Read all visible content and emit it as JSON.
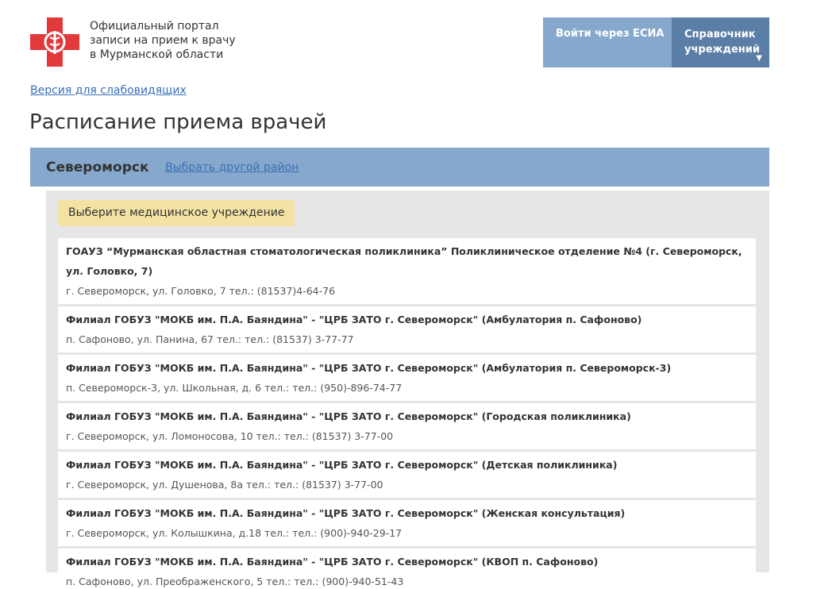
{
  "header": {
    "portal_title_lines": [
      "Официальный портал",
      "записи на прием к врачу",
      "в Мурманской области"
    ],
    "esia_button": "Войти через ЕСИА",
    "directory_button_lines": [
      "Справочник",
      "учреждений"
    ],
    "caret": "▼"
  },
  "accessibility_link": "Версия для слабовидящих",
  "page_title": "Расписание приема врачей",
  "district": {
    "name": "Североморск",
    "change_link": "Выбрать другой район"
  },
  "select_prompt": "Выберите медицинское учреждение",
  "institutions": [
    {
      "name": "ГОАУЗ “Мурманская областная стоматологическая поликлиника” Поликлиническое отделение №4 (г. Североморск, ул. Головко, 7)",
      "address": "г. Североморск, ул. Головко, 7 тел.: (81537)4-64-76"
    },
    {
      "name": "Филиал ГОБУЗ \"МОКБ им. П.А. Баяндина\" - \"ЦРБ ЗАТО г. Североморск\" (Амбулатория п. Сафоново)",
      "address": "п. Сафоново, ул. Панина, 67 тел.: тел.: (81537) 3-77-77"
    },
    {
      "name": "Филиал ГОБУЗ \"МОКБ им. П.А. Баяндина\" - \"ЦРБ ЗАТО г. Североморск\" (Амбулатория п. Североморск-3)",
      "address": "п. Североморск-3, ул. Школьная, д. 6 тел.: тел.: (950)-896-74-77"
    },
    {
      "name": "Филиал ГОБУЗ \"МОКБ им. П.А. Баяндина\" - \"ЦРБ ЗАТО г. Североморск\" (Городская поликлиника)",
      "address": "г. Североморск, ул. Ломоносова, 10 тел.: тел.: (81537) 3-77-00"
    },
    {
      "name": "Филиал ГОБУЗ \"МОКБ им. П.А. Баяндина\" - \"ЦРБ ЗАТО г. Североморск\" (Детская поликлиника)",
      "address": "г. Североморск, ул. Душенова, 8а тел.: тел.: (81537) 3-77-00"
    },
    {
      "name": "Филиал ГОБУЗ \"МОКБ им. П.А. Баяндина\" - \"ЦРБ ЗАТО г. Североморск\" (Женская консультация)",
      "address": "г. Североморск, ул. Колышкина, д.18 тел.: тел.: (900)-940-29-17"
    },
    {
      "name": "Филиал ГОБУЗ \"МОКБ им. П.А. Баяндина\" - \"ЦРБ ЗАТО г. Североморск\" (КВОП п. Сафоново)",
      "address": "п. Сафоново, ул. Преображенского, 5 тел.: тел.: (900)-940-51-43"
    }
  ],
  "colors": {
    "logo_red": "#e2393b",
    "district_bar": "#86a8cc",
    "esia_button": "#86a8cc",
    "directory_button": "#5a7ea5",
    "link": "#3a6fb5",
    "badge": "#f3e2a4",
    "panel": "#e6e6e6"
  },
  "icons": {
    "logo": "medical-cross-caduceus-icon",
    "caret": "caret-down-icon"
  }
}
